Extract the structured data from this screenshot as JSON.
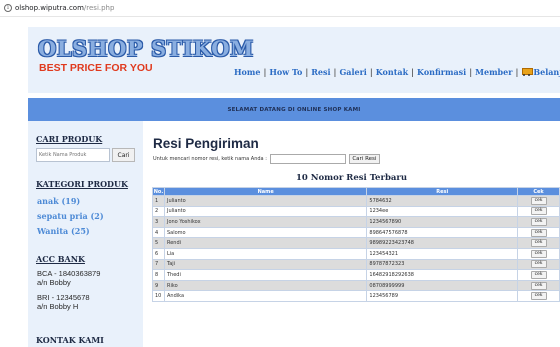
{
  "browser": {
    "url_host": "olshop.wiputra.com",
    "url_path": "/resi.php"
  },
  "header": {
    "logo": "OLSHOP STIKOM",
    "tagline": "BEST PRICE FOR YOU",
    "nav": [
      "Home",
      "How To",
      "Resi",
      "Galeri",
      "Kontak",
      "Konfirmasi",
      "Member",
      "Belanja"
    ]
  },
  "welcome": "SELAMAT DATANG DI ONLINE SHOP KAMI",
  "sidebar": {
    "cari_title": "CARI PRODUK",
    "search_placeholder": "Ketik Nama Produk",
    "search_button": "Cari",
    "kategori_title": "KATEGORI PRODUK",
    "categories": [
      "anak (19)",
      "sepatu pria (2)",
      "Wanita (25)"
    ],
    "acc_title": "ACC BANK",
    "banks": [
      {
        "line1": "BCA - 1840363879",
        "line2": "a/n Bobby"
      },
      {
        "line1": "BRI - 12345678",
        "line2": "a/n Bobby H"
      }
    ],
    "kontak_title": "KONTAK KAMI"
  },
  "main": {
    "title": "Resi Pengiriman",
    "search_label": "Untuk mencari nomor resi, ketik nama Anda :",
    "search_value": "",
    "search_button": "Cari Resi",
    "table_title": "10 Nomor Resi Terbaru",
    "columns": [
      "No.",
      "Name",
      "Resi",
      "Cek"
    ],
    "rows": [
      {
        "no": "1",
        "name": "Julianto",
        "resi": "5784632",
        "cek": "cek"
      },
      {
        "no": "2",
        "name": "Julianto",
        "resi": "1234ee",
        "cek": "cek"
      },
      {
        "no": "3",
        "name": "Jono Yoshikox",
        "resi": "1234567890",
        "cek": "cek"
      },
      {
        "no": "4",
        "name": "Salomo",
        "resi": "898647576878",
        "cek": "cek"
      },
      {
        "no": "5",
        "name": "Rendi",
        "resi": "98989223423748",
        "cek": "cek"
      },
      {
        "no": "6",
        "name": "Lia",
        "resi": "123454321",
        "cek": "cek"
      },
      {
        "no": "7",
        "name": "Taji",
        "resi": "89787872323",
        "cek": "cek"
      },
      {
        "no": "8",
        "name": "Thedi",
        "resi": "16482918292638",
        "cek": "cek"
      },
      {
        "no": "9",
        "name": "Riko",
        "resi": "08708999999",
        "cek": "cek"
      },
      {
        "no": "10",
        "name": "Andika",
        "resi": "123456789",
        "cek": "cek"
      }
    ]
  },
  "colors": {
    "accent_blue": "#5b8fde",
    "header_bg": "#e9f1fb",
    "tagline_red": "#e03a1e",
    "link_blue": "#2c6cc4"
  }
}
